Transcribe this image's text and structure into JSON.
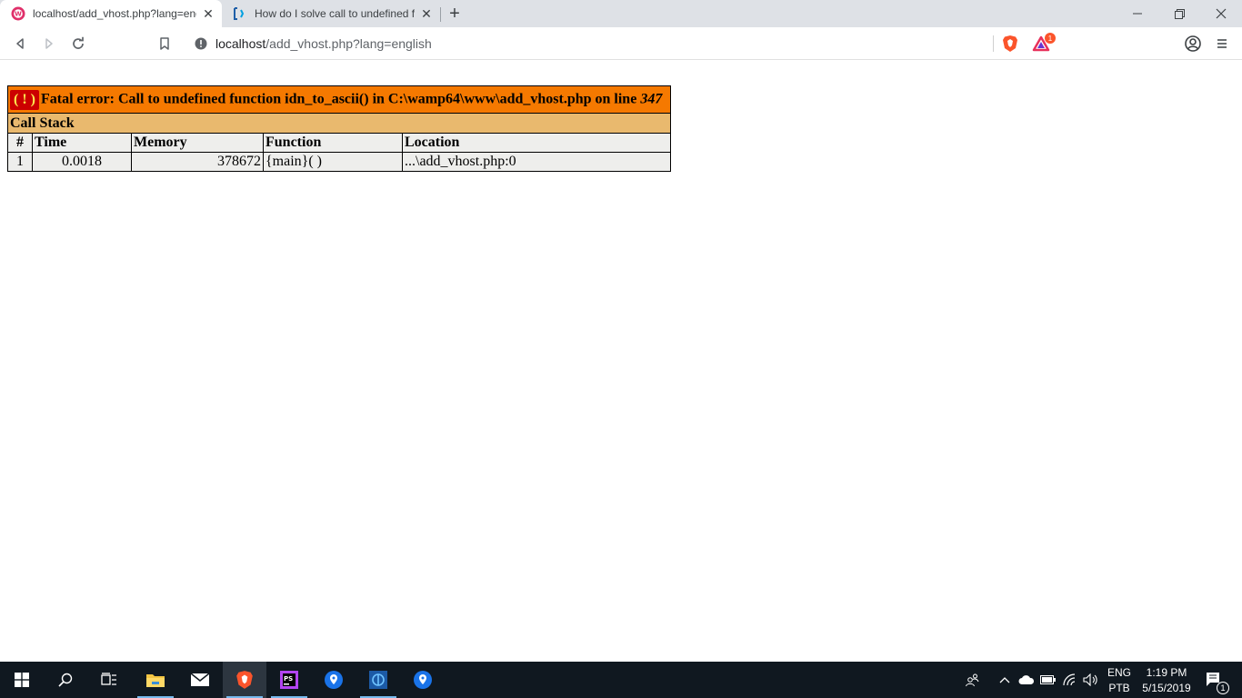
{
  "browser": {
    "tabs": [
      {
        "title": "localhost/add_vhost.php?lang=eng",
        "favicon": "wampserver-icon",
        "active": true
      },
      {
        "title": "How do I solve call to undefined fu",
        "favicon": "stackoverflow-icon",
        "active": false
      }
    ],
    "new_tab": "+",
    "address": {
      "host": "localhost",
      "path": "/add_vhost.php?lang=english"
    },
    "rewards_badge": "1"
  },
  "error": {
    "badge": "( ! )",
    "message": "Fatal error: Call to undefined function idn_to_ascii() in C:\\wamp64\\www\\add_vhost.php on line ",
    "line": "347",
    "call_stack_title": "Call Stack",
    "columns": [
      "#",
      "Time",
      "Memory",
      "Function",
      "Location"
    ],
    "rows": [
      {
        "num": "1",
        "time": "0.0018",
        "memory": "378672",
        "function": "{main}( )",
        "location": "...\\add_vhost.php:0"
      }
    ]
  },
  "taskbar": {
    "apps": [
      "windows-start-icon",
      "search-icon",
      "task-view-icon",
      "file-explorer-icon",
      "mail-icon",
      "brave-icon",
      "phpstorm-icon",
      "maps-icon",
      "app-icon",
      "maps-icon"
    ],
    "language": {
      "line1": "ENG",
      "line2": "PTB"
    },
    "clock": {
      "time": "1:19 PM",
      "date": "5/15/2019"
    },
    "notifications_count": "1"
  }
}
